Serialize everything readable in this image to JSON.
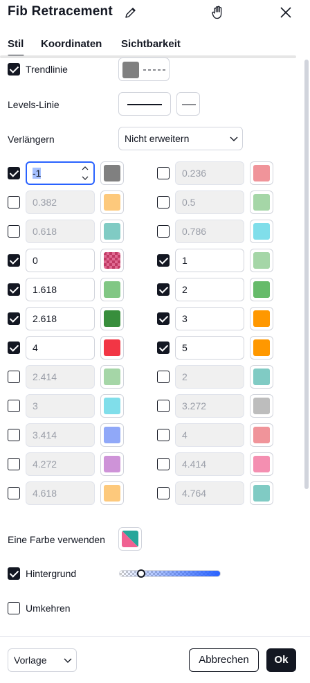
{
  "header": {
    "title": "Fib Retracement",
    "icons": {
      "edit": "pencil-icon",
      "drag": "hand-icon",
      "close": "close-icon"
    }
  },
  "tabs": [
    {
      "label": "Stil",
      "active": true
    },
    {
      "label": "Koordinaten",
      "active": false
    },
    {
      "label": "Sichtbarkeit",
      "active": false
    }
  ],
  "trend": {
    "label": "Trendlinie",
    "checked": true,
    "color": "#808080"
  },
  "levels_line": {
    "label": "Levels-Linie"
  },
  "extend": {
    "label": "Verlängern",
    "value": "Nicht erweitern"
  },
  "levels": [
    {
      "value": "-1",
      "checked": true,
      "color": "#808080"
    },
    {
      "value": "0.236",
      "checked": false,
      "color": "#f0949a"
    },
    {
      "value": "0.382",
      "checked": false,
      "color": "#fdc97c"
    },
    {
      "value": "0.5",
      "checked": false,
      "color": "#a5d6a7"
    },
    {
      "value": "0.618",
      "checked": false,
      "color": "#80cbc4"
    },
    {
      "value": "0.786",
      "checked": false,
      "color": "#80deea"
    },
    {
      "value": "0",
      "checked": true,
      "color": "#c03a64",
      "pattern": "checker"
    },
    {
      "value": "1",
      "checked": true,
      "color": "#a5d6a7"
    },
    {
      "value": "1.618",
      "checked": true,
      "color": "#81c784"
    },
    {
      "value": "2",
      "checked": true,
      "color": "#66bb6a"
    },
    {
      "value": "2.618",
      "checked": true,
      "color": "#388e3c"
    },
    {
      "value": "3",
      "checked": true,
      "color": "#ff9800"
    },
    {
      "value": "4",
      "checked": true,
      "color": "#f23645"
    },
    {
      "value": "5",
      "checked": true,
      "color": "#ff9800"
    },
    {
      "value": "2.414",
      "checked": false,
      "color": "#a5d6a7"
    },
    {
      "value": "2",
      "checked": false,
      "color": "#80cbc4"
    },
    {
      "value": "3",
      "checked": false,
      "color": "#80deea"
    },
    {
      "value": "3.272",
      "checked": false,
      "color": "#bdbdbd"
    },
    {
      "value": "3.414",
      "checked": false,
      "color": "#90a8f8"
    },
    {
      "value": "4",
      "checked": false,
      "color": "#f0949a"
    },
    {
      "value": "4.272",
      "checked": false,
      "color": "#ce93d8"
    },
    {
      "value": "4.414",
      "checked": false,
      "color": "#f48fb1"
    },
    {
      "value": "4.618",
      "checked": false,
      "color": "#fdc97c"
    },
    {
      "value": "4.764",
      "checked": false,
      "color": "#80cbc4"
    }
  ],
  "one_color": {
    "label": "Eine Farbe verwenden",
    "colors": [
      "#26a69a",
      "#f06292"
    ]
  },
  "background": {
    "label": "Hintergrund",
    "checked": true,
    "opacity_fraction": 0.22,
    "color": "#2962ff"
  },
  "reverse": {
    "label": "Umkehren",
    "checked": false
  },
  "footer": {
    "template": "Vorlage",
    "cancel": "Abbrechen",
    "ok": "Ok"
  }
}
